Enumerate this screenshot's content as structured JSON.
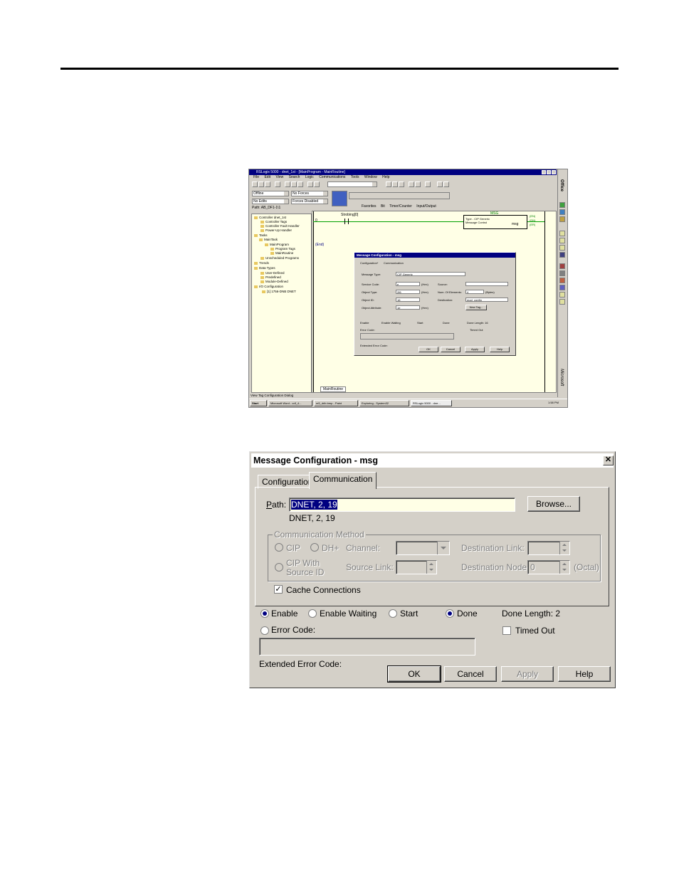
{
  "screenshot1": {
    "title": "RSLogix 5000 - dnet_1st - [MainProgram - MainRoutine]",
    "menu": [
      "File",
      "Edit",
      "View",
      "Search",
      "Logic",
      "Communications",
      "Tools",
      "Window",
      "Help"
    ],
    "mode_combo": "Offline",
    "forces_combo": "No Forces",
    "edits_combo": "No Edits",
    "forces_disabled_combo": "Forces Disabled",
    "path": "Path: AB_DF1-1\\1",
    "tabs": [
      "Favorites",
      "Bit",
      "Timer/Counter",
      "Input/Output"
    ],
    "tree": [
      "Controller dnet_1st",
      "Controller Tags",
      "Controller Fault Handler",
      "Power-Up Handler",
      "Tasks",
      "MainTask",
      "MainProgram",
      "Program Tags",
      "MainRoutine",
      "Unscheduled Programs",
      "Trends",
      "Data Types",
      "User-Defined",
      "Predefined",
      "Module-Defined",
      "I/O Configuration",
      "[1] 1756-DNB DNET"
    ],
    "rung0": "0",
    "rung_end": "(End)",
    "contact_tag": "Strobing[0]",
    "msg_block": {
      "header": "MSG",
      "line1": "Type - CIP Generic",
      "line2": "Message Control",
      "tag": "msg",
      "outputs": [
        "(EN)",
        "(DN)",
        "(ER)"
      ]
    },
    "mini_dialog": {
      "title": "Message Configuration - msg",
      "tabs": [
        "Configuration*",
        "Communication"
      ],
      "message_type_label": "Message Type:",
      "message_type": "CIP Generic",
      "service_code_label": "Service Code:",
      "service_code": "e",
      "hex": "(Hex)",
      "source_label": "Source:",
      "object_type_label": "Object Type:",
      "object_type": "2f6",
      "num_elements_label": "Num. Of Elements:",
      "num_elements": "4",
      "bytes": "(Bytes)",
      "object_id_label": "Object ID:",
      "object_id": "16",
      "destination_label": "Destination:",
      "destination": "mod_config",
      "object_attribute_label": "Object Attribute:",
      "object_attribute": "1e",
      "new_tag": "New Tag...",
      "status": [
        "Enable",
        "Enable Waiting",
        "Start",
        "Done"
      ],
      "done_length": "Done Length: 16",
      "error_code": "Error Code:",
      "timed_out": "Timed Out",
      "extended_error": "Extended Error Code:",
      "buttons": [
        "OK",
        "Cancel",
        "Apply",
        "Help"
      ]
    },
    "sheet_tab": "MainRoutine",
    "status_bar": "View Tag Configuration Dialog",
    "office_label": "Office",
    "microsoft_label": "Microsoft",
    "taskbar": {
      "start": "Start",
      "items": [
        "Microsoft Word - cdf_4...",
        "m5_drib.bmp - Paint",
        "Exploring - System32",
        "RSLogix 5000 - dne..."
      ],
      "clock": "1:58 PM"
    }
  },
  "dialog": {
    "title": "Message Configuration - msg",
    "close": "✕",
    "tabs": {
      "configuration": "Configuration",
      "communication": "Communication"
    },
    "path_label": "Path:",
    "path_value": "DNET, 2, 19",
    "path_echo": "DNET, 2, 19",
    "browse": "Browse...",
    "comm_method": "Communication Method",
    "cip": "CIP",
    "dh_plus": "DH+",
    "channel": "Channel:",
    "destination_link": "Destination Link:",
    "cip_with_1": "CIP With",
    "cip_with_2": "Source ID",
    "source_link": "Source Link:",
    "destination_node": "Destination Node:",
    "dest_node_value": "0",
    "octal": "(Octal)",
    "cache_connections": "Cache Connections",
    "cache_checked": "✓",
    "enable": "Enable",
    "enable_waiting": "Enable Waiting",
    "start": "Start",
    "done": "Done",
    "done_length": "Done Length:  2",
    "error_code": "Error Code:",
    "timed_out": "Timed Out",
    "extended_error": "Extended Error Code:",
    "ok": "OK",
    "cancel": "Cancel",
    "apply": "Apply",
    "help": "Help"
  }
}
